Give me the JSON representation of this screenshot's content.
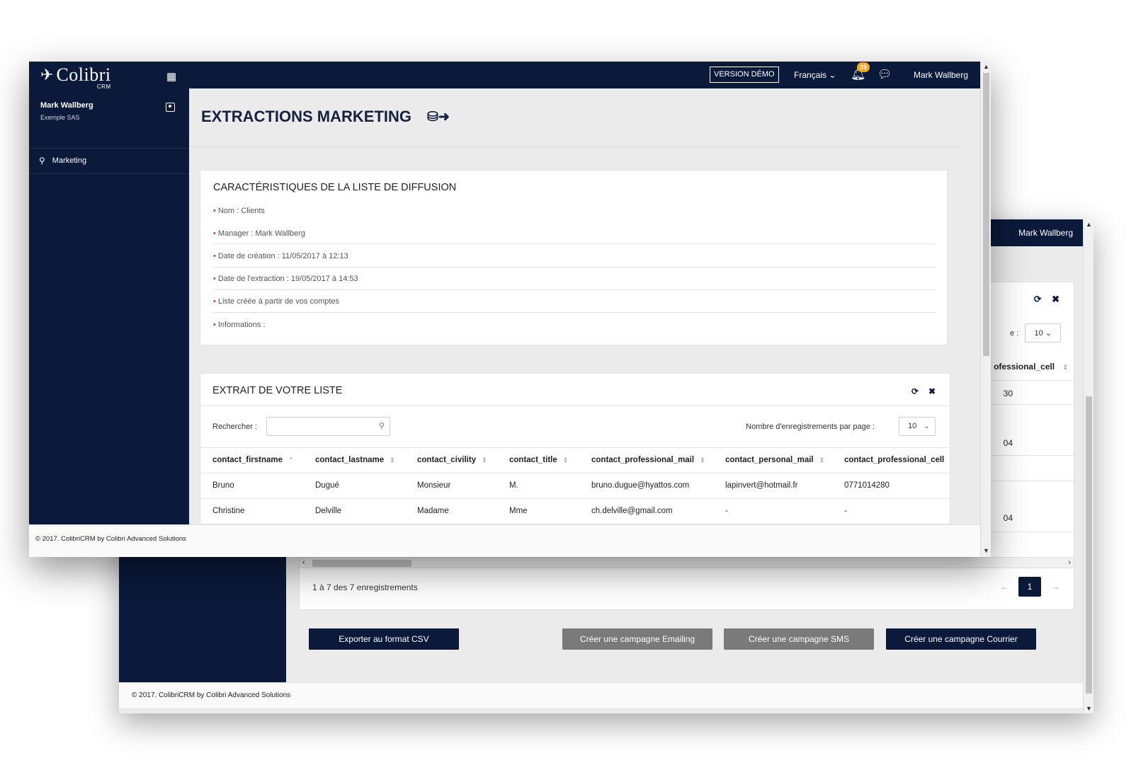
{
  "app": {
    "logo_text": "Colibri",
    "logo_sub": "CRM",
    "demo_label": "VERSION DÉMO",
    "language": "Français",
    "notification_count": "25",
    "user_name": "Mark Wallberg"
  },
  "sidebar": {
    "user_name": "Mark Wallberg",
    "company": "Exemple SAS",
    "items": [
      {
        "label": "Marketing",
        "icon": "marketing-icon"
      }
    ]
  },
  "page": {
    "title": "EXTRACTIONS MARKETING",
    "title_icon": "export-database-icon"
  },
  "list_info": {
    "title": "CARACTÉRISTIQUES DE LA LISTE DE DIFFUSION",
    "items": [
      "Nom : Clients",
      "Manager : Mark Wallberg",
      "Date de création : 11/05/2017 à 12:13",
      "Date de l'extraction : 19/05/2017 à 14:53",
      "Liste créée à partir de vos comptes",
      "Informations :"
    ]
  },
  "extract": {
    "title": "EXTRAIT DE VOTRE LISTE",
    "search_label": "Rechercher :",
    "search_value": "",
    "per_page_label": "Nombre d'enregistrements par page :",
    "per_page_value": "10",
    "columns": [
      "contact_firstname",
      "contact_lastname",
      "contact_civility",
      "contact_title",
      "contact_professional_mail",
      "contact_personal_mail",
      "contact_professional_cell"
    ],
    "sort_column": "contact_firstname",
    "sort_direction": "ascending",
    "rows": [
      [
        "Bruno",
        "Dugué",
        "Monsieur",
        "M.",
        "bruno.dugue@hyattos.com",
        "lapinvert@hotmail.fr",
        "0771014280"
      ],
      [
        "Christine",
        "Delville",
        "Madame",
        "Mme",
        "ch.delville@gmail.com",
        "-",
        "-"
      ]
    ]
  },
  "footer": {
    "text": "© 2017. ColibriCRM by Colibri Advanced Solutions"
  },
  "back_window": {
    "user_name": "Mark Wallberg",
    "per_page_suffix": "e :",
    "per_page_value": "10",
    "column_fragment": "ofessional_cell",
    "cell_fragments": [
      "30",
      "04",
      "04"
    ],
    "pagination_info": "1 à 7 des 7 enregistrements",
    "current_page": "1",
    "prev_label": "←",
    "next_label": "→",
    "buttons": {
      "export_csv": "Exporter au format CSV",
      "emailing": "Créer une campagne Emailing",
      "sms": "Créer une campagne SMS",
      "courrier": "Créer une campagne Courrier"
    },
    "footer_text": "© 2017. ColibriCRM by Colibri Advanced Solutions"
  },
  "colors": {
    "navy": "#0b1a3b",
    "badge": "#f5a623",
    "bullet": "#c0392b",
    "grey_button": "#7a7a7a"
  }
}
